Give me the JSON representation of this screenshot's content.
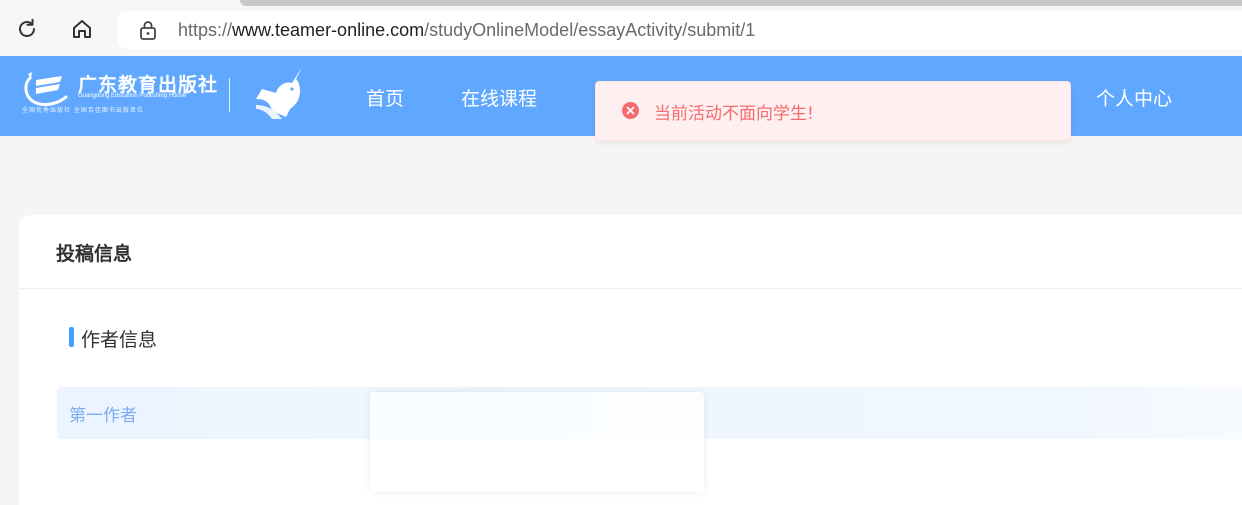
{
  "browser": {
    "url_prefix": "https://",
    "url_host": "www.teamer-online.com",
    "url_path": "/studyOnlineModel/essayActivity/submit/1",
    "icons": {
      "reload": "reload-icon",
      "home": "home-icon",
      "lock": "lock-icon"
    }
  },
  "header": {
    "logo_title": "广东教育出版社",
    "logo_subtitle": "Guangdong Education Publishing House",
    "logo_slogan": "全国优秀出版社  全国百佳图书出版单位",
    "nav": [
      {
        "label": "首页"
      },
      {
        "label": "在线课程"
      },
      {
        "label": "个人中心"
      }
    ],
    "colors": {
      "background": "#60a8ff"
    }
  },
  "toast": {
    "message": "当前活动不面向学生!",
    "icon": "error-circle-icon",
    "colors": {
      "text": "#f56c6c",
      "background": "#fef0f0"
    }
  },
  "main": {
    "card_title": "投稿信息",
    "section_label": "作者信息",
    "author_row_label": "第一作者",
    "colors": {
      "accent": "#409eff"
    }
  }
}
